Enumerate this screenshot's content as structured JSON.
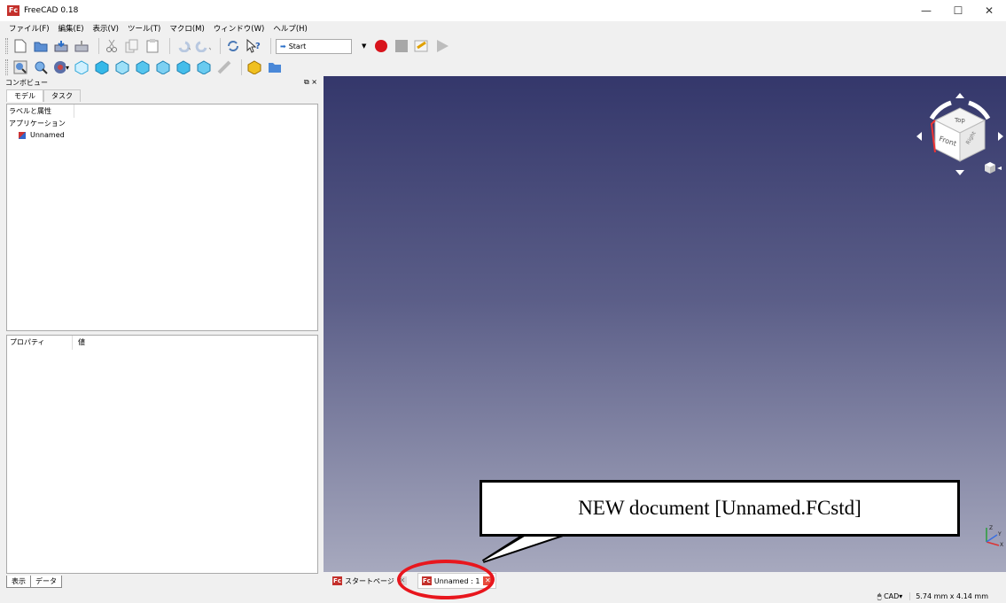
{
  "window": {
    "title": "FreeCAD 0.18",
    "logo": "Fc",
    "minimize": "—",
    "maximize": "☐",
    "close": "✕"
  },
  "menu": [
    "ファイル(F)",
    "編集(E)",
    "表示(V)",
    "ツール(T)",
    "マクロ(M)",
    "ウィンドウ(W)",
    "ヘルプ(H)"
  ],
  "toolbar": {
    "workbench": "Start",
    "icons": [
      "new-document",
      "open",
      "save",
      "save-as",
      "cut",
      "copy",
      "paste",
      "undo",
      "redo",
      "refresh",
      "whats-this",
      "record-macro",
      "stop-macro",
      "edit-macro",
      "run-macro"
    ],
    "view_icons": [
      "fit-all",
      "fit-selection",
      "draw-style",
      "isometric",
      "front",
      "top",
      "right",
      "rear",
      "bottom",
      "left",
      "measure",
      "part",
      "group"
    ]
  },
  "left_panel": {
    "title": "コンボビュー",
    "float_icon": "⧉",
    "close_icon": "×",
    "tabs": [
      "モデル",
      "タスク"
    ],
    "tree_header": "ラベルと属性",
    "tree_root": "アプリケーション",
    "tree_child": "Unnamed",
    "props_col1": "プロパティ",
    "props_col2": "値",
    "bottom_tabs": [
      "表示",
      "データ"
    ]
  },
  "viewport": {
    "navcube": {
      "top": "Top",
      "front": "Front",
      "right": "Right"
    },
    "axes": {
      "x": "X",
      "y": "Y",
      "z": "Z"
    }
  },
  "annotation": {
    "callout_text": "NEW document [Unnamed.FCstd]"
  },
  "document_tabs": [
    {
      "label": "スタートページ",
      "active": false
    },
    {
      "label": "Unnamed : 1",
      "active": true
    }
  ],
  "status": {
    "navigation": "CAD▾",
    "dimensions": "5.74 mm x 4.14 mm"
  }
}
